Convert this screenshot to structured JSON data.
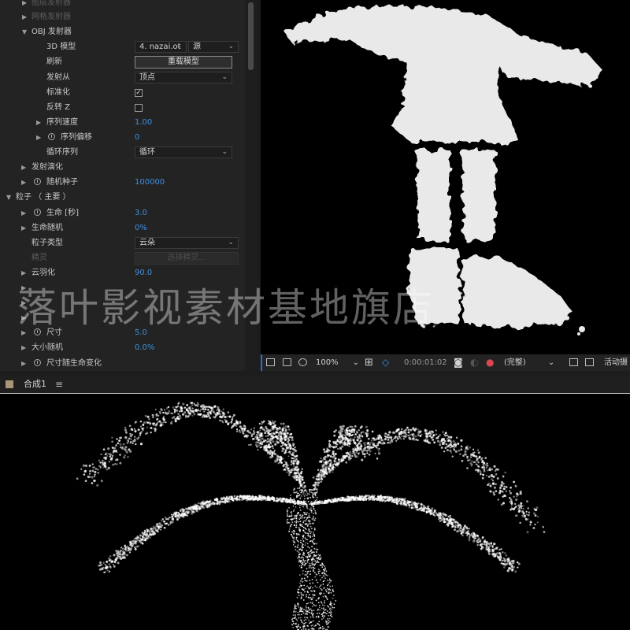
{
  "effect_controls": {
    "rows": [
      {
        "label": "图层发射器"
      },
      {
        "label": "网格发射器"
      },
      {
        "label": "OBJ 发射器"
      },
      {
        "label": "3D 模型",
        "model_value": "4. nazai.ot",
        "source_value": "源"
      },
      {
        "label": "刷新",
        "button": "重载模型"
      },
      {
        "label": "发射从",
        "value": "顶点"
      },
      {
        "label": "标准化",
        "checked": true
      },
      {
        "label": "反转 Z",
        "checked": false
      },
      {
        "label": "序列速度",
        "value": "1.00"
      },
      {
        "label": "序列偏移",
        "value": "0"
      },
      {
        "label": "循环序列",
        "value": "循环"
      },
      {
        "label": "发射演化"
      },
      {
        "label": "随机种子",
        "value": "100000"
      },
      {
        "label": "粒子 （ 主要 ）"
      },
      {
        "label": "生命 [秒]",
        "value": "3.0"
      },
      {
        "label": "生命随机",
        "value": "0%"
      },
      {
        "label": "粒子类型",
        "value": "云朵"
      },
      {
        "label": "精灵",
        "button": "选择精灵..."
      },
      {
        "label": "云羽化",
        "value": "90.0"
      },
      {
        "label": "",
        "value": ""
      },
      {
        "label": "",
        "value": ""
      },
      {
        "label": "",
        "value": ""
      },
      {
        "label": "尺寸",
        "value": "5.0"
      },
      {
        "label": "大小随机",
        "value": "0.0%"
      },
      {
        "label": "尺寸随生命变化"
      }
    ]
  },
  "viewer_toolbar": {
    "zoom": "100%",
    "timecode": "0:00:01:02",
    "resolution": "(完整)",
    "camera": "活动摄"
  },
  "composition": {
    "tab_label": "合成1"
  },
  "watermark": "落叶影视素材基地旗店",
  "colors": {
    "value_blue": "#3d8fe0",
    "panel_bg": "#232323",
    "viewer_bg": "#000000",
    "viewer_highlight": "#2b6fc9"
  },
  "icons": [
    "twirl-open-icon",
    "twirl-closed-icon",
    "stopwatch-icon",
    "checkbox-icon",
    "snapshot-icon",
    "channel-icon",
    "menu-icon"
  ]
}
